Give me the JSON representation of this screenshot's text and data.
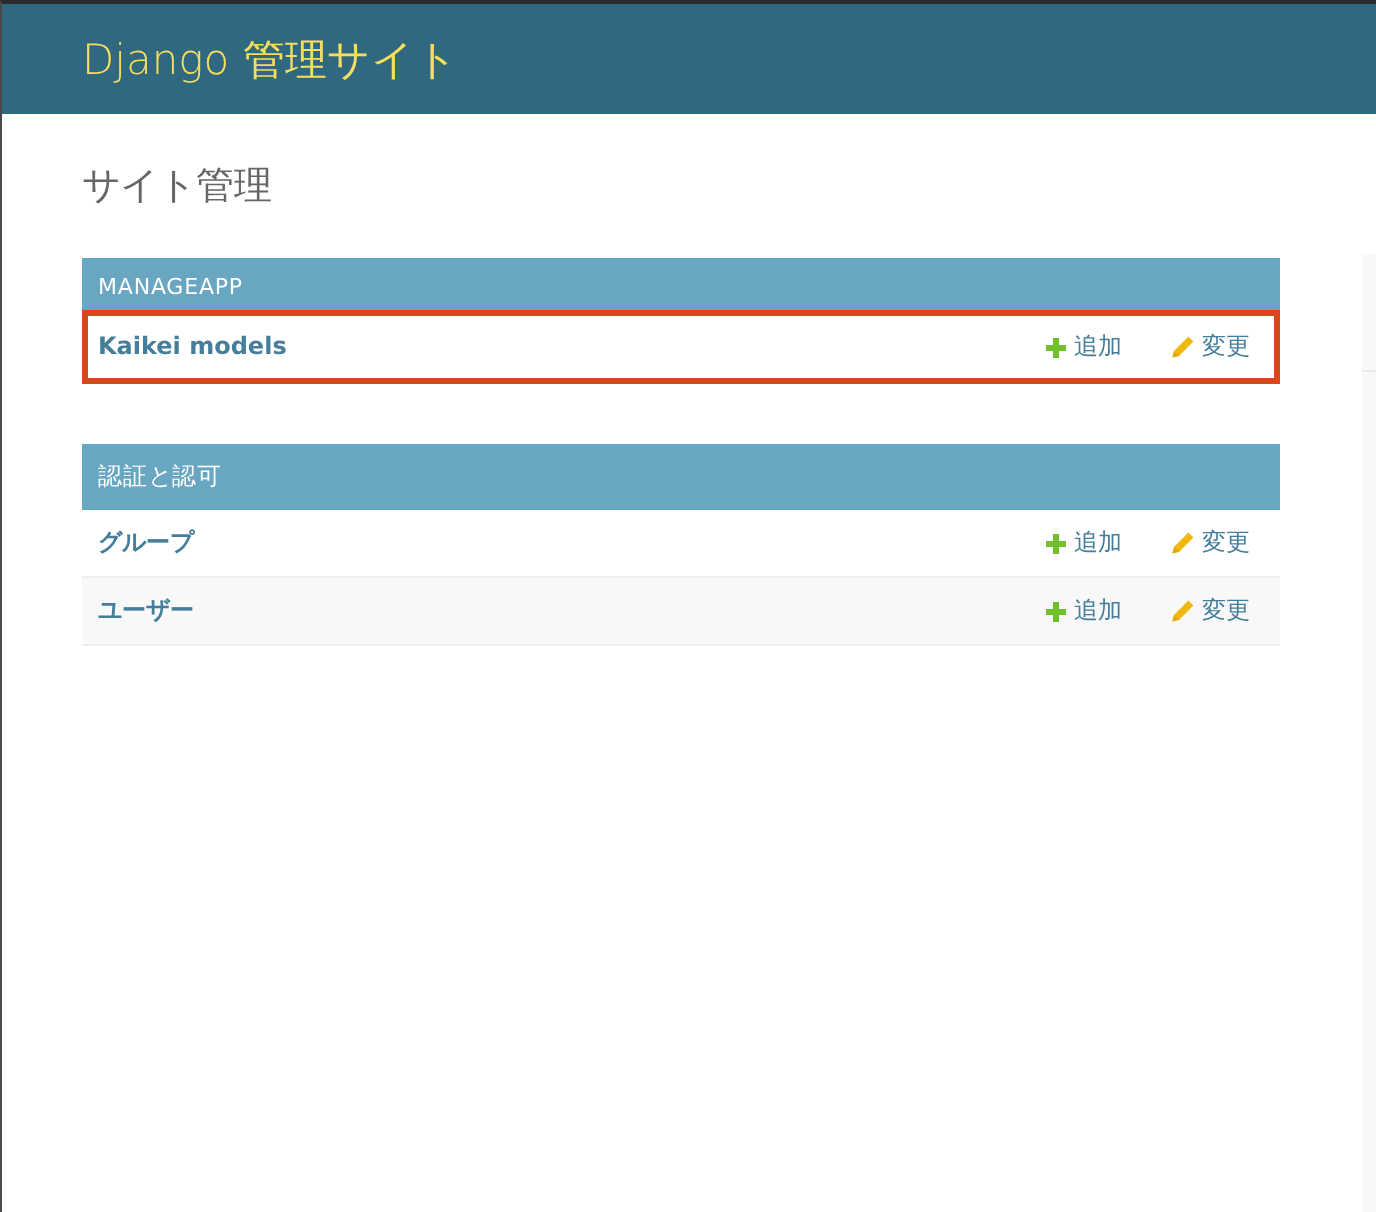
{
  "header": {
    "title": "Django 管理サイト"
  },
  "page": {
    "title": "サイト管理"
  },
  "modules": [
    {
      "caption": "MANAGEAPP",
      "models": [
        {
          "name": "Kaikei models",
          "highlighted": true,
          "add_label": "追加",
          "change_label": "変更"
        }
      ]
    },
    {
      "caption": "認証と認可",
      "models": [
        {
          "name": "グループ",
          "highlighted": false,
          "add_label": "追加",
          "change_label": "変更"
        },
        {
          "name": "ユーザー",
          "highlighted": false,
          "add_label": "追加",
          "change_label": "変更"
        }
      ]
    }
  ]
}
